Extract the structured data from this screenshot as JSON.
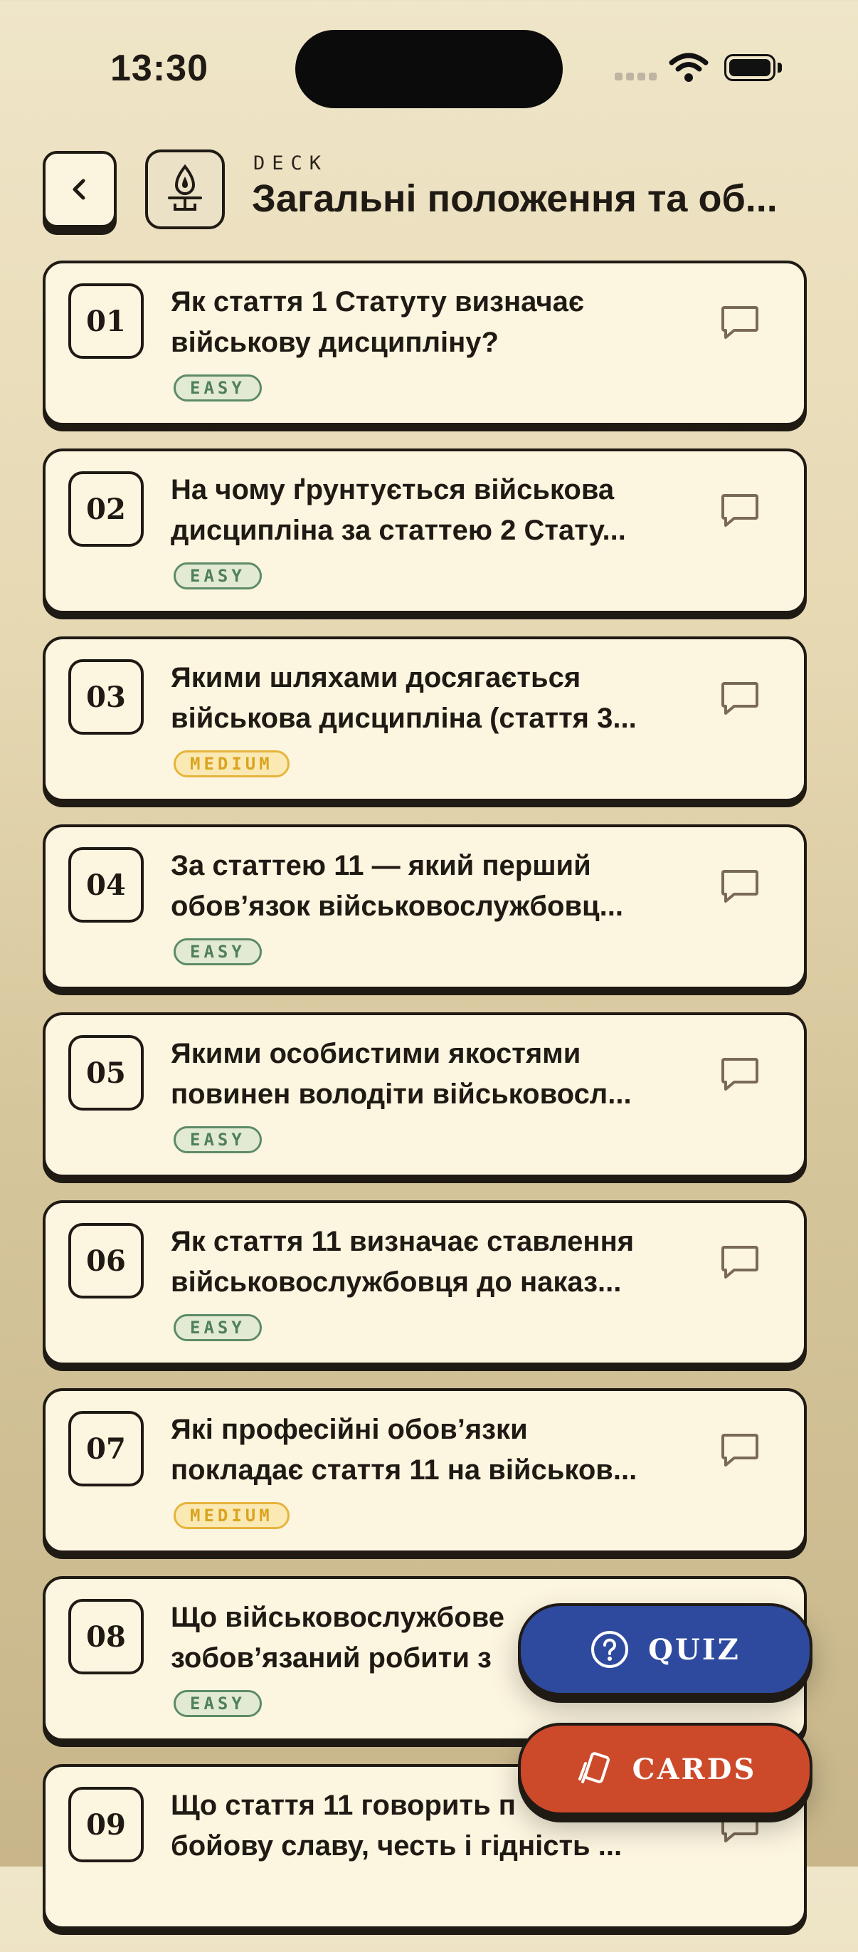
{
  "status_bar": {
    "time": "13:30"
  },
  "header": {
    "back_icon": "chevron-left-icon",
    "deck_icon": "lamp-icon",
    "label": "DECK",
    "title": "Загальні положення та об..."
  },
  "cards": [
    {
      "num": "01",
      "line1": "Як стаття 1 Статуту визначає",
      "line2": "військову дисципліну?",
      "level": "EASY"
    },
    {
      "num": "02",
      "line1": "На чому ґрунтується військова",
      "line2": "дисципліна за статтею 2 Стату...",
      "level": "EASY"
    },
    {
      "num": "03",
      "line1": "Якими шляхами досягається",
      "line2": "військова дисципліна (стаття 3...",
      "level": "MEDIUM"
    },
    {
      "num": "04",
      "line1": "За статтею 11 — який перший",
      "line2": "обовʼязок військовослужбовц...",
      "level": "EASY"
    },
    {
      "num": "05",
      "line1": "Якими особистими якостями",
      "line2": "повинен володіти військовосл...",
      "level": "EASY"
    },
    {
      "num": "06",
      "line1": "Як стаття 11 визначає ставлення",
      "line2": "військовослужбовця до наказ...",
      "level": "EASY"
    },
    {
      "num": "07",
      "line1": "Які професійні обовʼязки",
      "line2": "покладає стаття 11 на військов...",
      "level": "MEDIUM"
    },
    {
      "num": "08",
      "line1": "Що військовослужбове",
      "line2": "зобовʼязаний робити з",
      "level": "EASY"
    },
    {
      "num": "09",
      "line1": "Що стаття 11 говорить п",
      "line2": "бойову славу, честь і гідність ...",
      "level": ""
    }
  ],
  "actions": {
    "quiz_label": "QUIZ",
    "cards_label": "CARDS"
  },
  "colors": {
    "easy": "#4f7f5b",
    "medium": "#d9a420",
    "quiz": "#2e4a9e",
    "cards": "#cc4a2a"
  }
}
